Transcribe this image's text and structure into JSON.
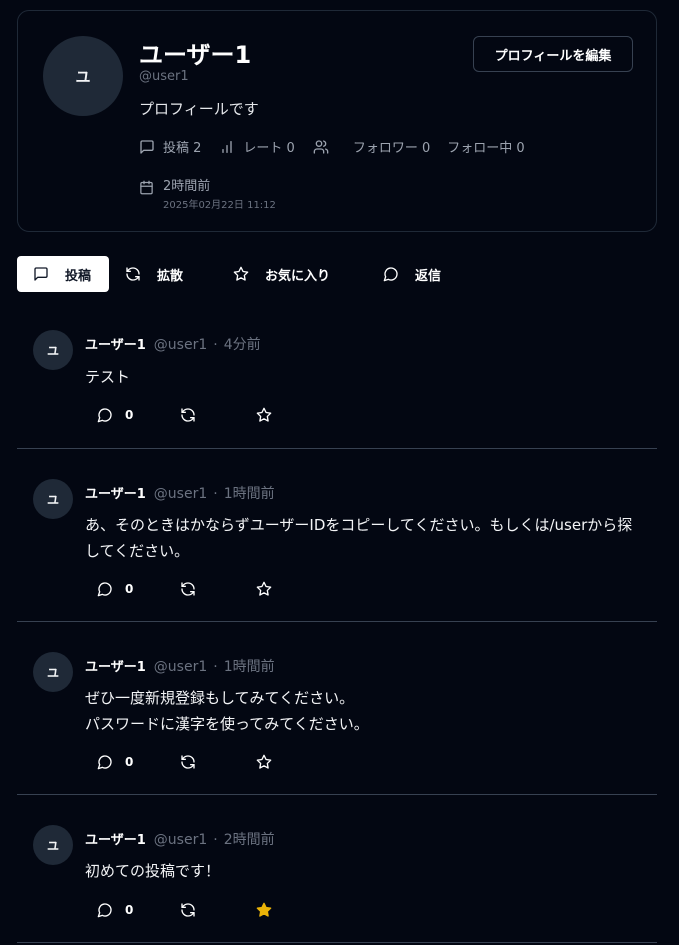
{
  "profile": {
    "avatar_initial": "ユ",
    "display_name": "ユーザー1",
    "handle": "@user1",
    "bio": "プロフィールです",
    "edit_button": "プロフィールを編集",
    "stats": {
      "posts": "投稿 2",
      "rate": "レート 0",
      "followers": "フォロワー 0",
      "following": "フォロー中 0"
    },
    "joined_relative": "2時間前",
    "joined_absolute": "2025年02月22日 11:12"
  },
  "tabs": [
    {
      "label": "投稿",
      "icon": "message-icon",
      "active": true
    },
    {
      "label": "拡散",
      "icon": "repost-icon",
      "active": false
    },
    {
      "label": "お気に入り",
      "icon": "star-icon",
      "active": false
    },
    {
      "label": "返信",
      "icon": "reply-icon",
      "active": false
    }
  ],
  "posts": [
    {
      "avatar": "ユ",
      "name": "ユーザー1",
      "handle": "@user1",
      "time": "4分前",
      "body": "テスト",
      "reply_count": "0",
      "favorited": false
    },
    {
      "avatar": "ユ",
      "name": "ユーザー1",
      "handle": "@user1",
      "time": "1時間前",
      "body": "あ、そのときはかならずユーザーIDをコピーしてください。もしくは/userから探してください。",
      "reply_count": "0",
      "favorited": false
    },
    {
      "avatar": "ユ",
      "name": "ユーザー1",
      "handle": "@user1",
      "time": "1時間前",
      "body": "ぜひ一度新規登録もしてみてください。\nパスワードに漢字を使ってみてください。",
      "reply_count": "0",
      "favorited": false
    },
    {
      "avatar": "ユ",
      "name": "ユーザー1",
      "handle": "@user1",
      "time": "2時間前",
      "body": "初めての投稿です！",
      "reply_count": "0",
      "favorited": true
    }
  ],
  "colors": {
    "background": "#030712",
    "border": "#1f2937",
    "divider": "#374151",
    "muted_text": "#6b7280",
    "favorite_star": "#eab308"
  }
}
